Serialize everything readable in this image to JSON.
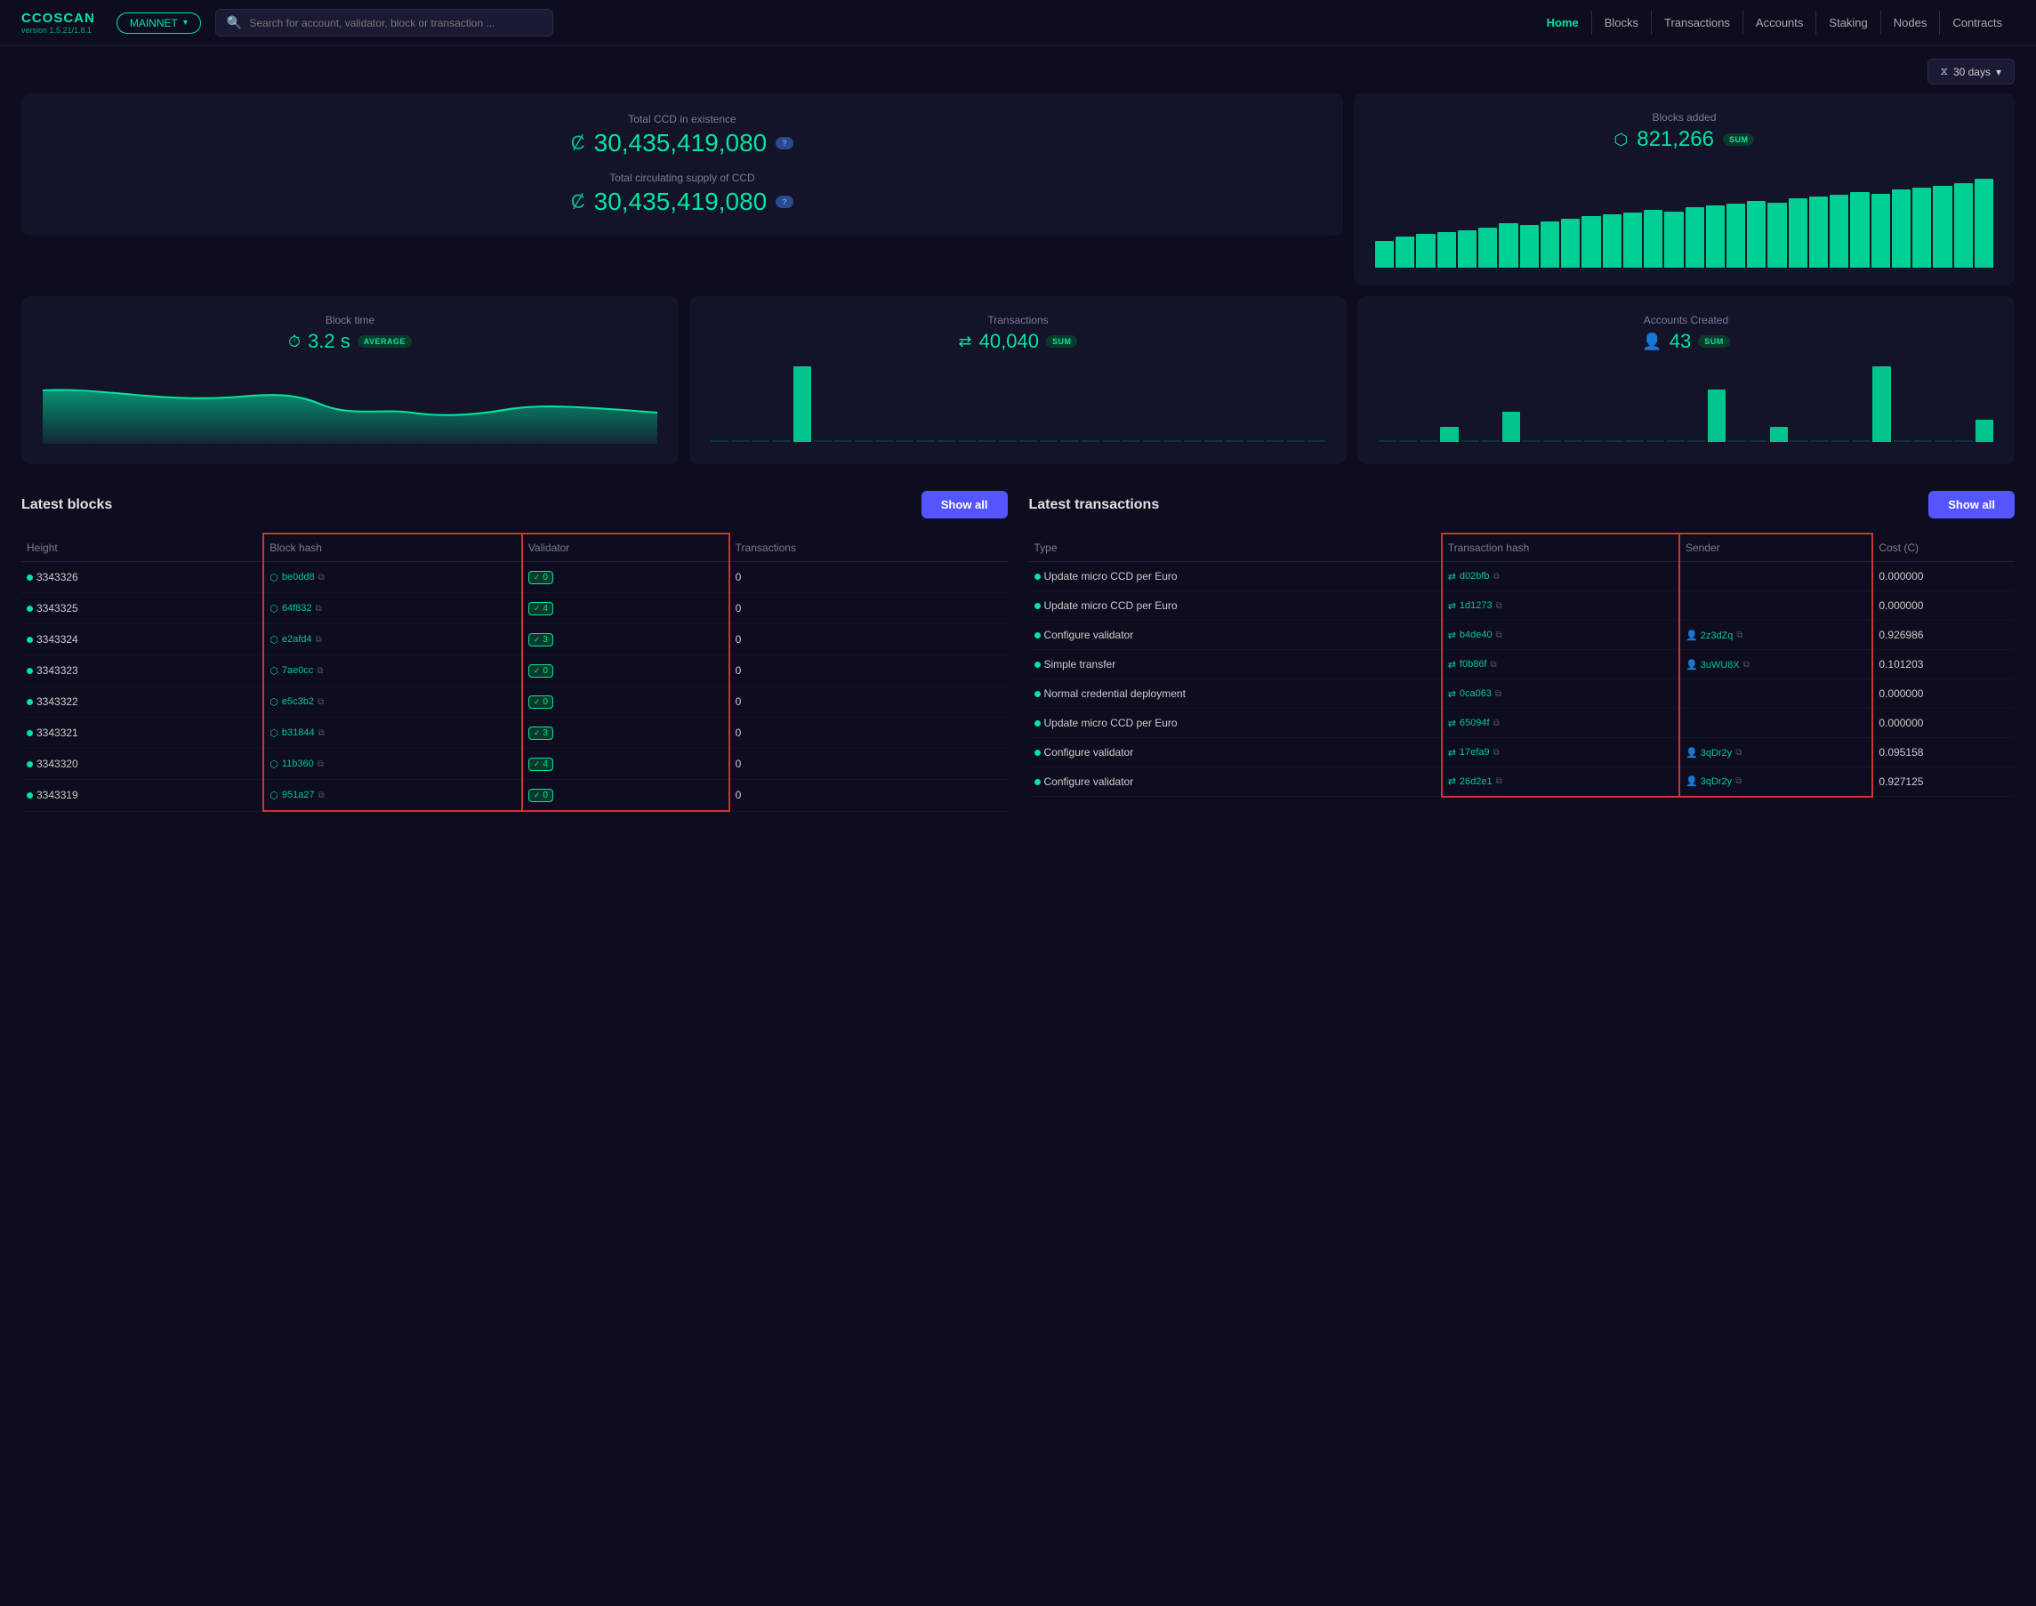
{
  "app": {
    "name": "CCOSCAN",
    "version": "version 1.5.21/1.8.1",
    "network": "MAINNET"
  },
  "header": {
    "search_placeholder": "Search for account, validator, block or transaction ...",
    "nav_items": [
      {
        "label": "Home",
        "active": true
      },
      {
        "label": "Blocks",
        "active": false
      },
      {
        "label": "Transactions",
        "active": false
      },
      {
        "label": "Accounts",
        "active": false
      },
      {
        "label": "Staking",
        "active": false
      },
      {
        "label": "Nodes",
        "active": false
      },
      {
        "label": "Contracts",
        "active": false
      }
    ]
  },
  "filter": {
    "label": "30 days"
  },
  "stats": {
    "total_ccd_label": "Total CCD in existence",
    "total_ccd_value": "30,435,419,080",
    "circulating_label": "Total circulating supply of CCD",
    "circulating_value": "30,435,419,080",
    "blocks_added_label": "Blocks added",
    "blocks_added_value": "821,266",
    "block_time_label": "Block time",
    "block_time_value": "3.2 s",
    "block_time_badge": "AVERAGE",
    "transactions_label": "Transactions",
    "transactions_value": "40,040",
    "transactions_badge": "SUM",
    "accounts_label": "Accounts Created",
    "accounts_value": "43",
    "accounts_badge": "SUM",
    "blocks_badge": "SUM"
  },
  "blocks": {
    "title": "Latest blocks",
    "show_all": "Show all",
    "columns": [
      "Height",
      "Block hash",
      "Validator",
      "Transactions"
    ],
    "rows": [
      {
        "height": "3343326",
        "hash": "be0dd8",
        "validator": "0",
        "transactions": "0"
      },
      {
        "height": "3343325",
        "hash": "64f832",
        "validator": "4",
        "transactions": "0"
      },
      {
        "height": "3343324",
        "hash": "e2afd4",
        "validator": "3",
        "transactions": "0"
      },
      {
        "height": "3343323",
        "hash": "7ae0cc",
        "validator": "0",
        "transactions": "0"
      },
      {
        "height": "3343322",
        "hash": "e5c3b2",
        "validator": "0",
        "transactions": "0"
      },
      {
        "height": "3343321",
        "hash": "b31844",
        "validator": "3",
        "transactions": "0"
      },
      {
        "height": "3343320",
        "hash": "11b360",
        "validator": "4",
        "transactions": "0"
      },
      {
        "height": "3343319",
        "hash": "951a27",
        "validator": "0",
        "transactions": "0"
      }
    ]
  },
  "transactions": {
    "title": "Latest transactions",
    "show_all": "Show all",
    "columns": [
      "Type",
      "Transaction hash",
      "Sender",
      "Cost (C)"
    ],
    "rows": [
      {
        "type": "Update micro CCD per Euro",
        "hash": "d02bfb",
        "sender": "",
        "cost": "0.000000"
      },
      {
        "type": "Update micro CCD per Euro",
        "hash": "1d1273",
        "sender": "",
        "cost": "0.000000"
      },
      {
        "type": "Configure validator",
        "hash": "b4de40",
        "sender": "2z3dZq",
        "cost": "0.926986"
      },
      {
        "type": "Simple transfer",
        "hash": "f0b86f",
        "sender": "3uWU8X",
        "cost": "0.101203"
      },
      {
        "type": "Normal credential deployment",
        "hash": "0ca063",
        "sender": "",
        "cost": "0.000000"
      },
      {
        "type": "Update micro CCD per Euro",
        "hash": "65094f",
        "sender": "",
        "cost": "0.000000"
      },
      {
        "type": "Configure validator",
        "hash": "17efa9",
        "sender": "3qDr2y",
        "cost": "0.095158"
      },
      {
        "type": "Configure validator",
        "hash": "26d2e1",
        "sender": "3qDr2y",
        "cost": "0.927125"
      }
    ]
  },
  "bar_heights": [
    30,
    35,
    38,
    40,
    42,
    45,
    50,
    48,
    52,
    55,
    58,
    60,
    62,
    65,
    63,
    68,
    70,
    72,
    75,
    73,
    78,
    80,
    82,
    85,
    83,
    88,
    90,
    92,
    95,
    100
  ],
  "tx_bar_heights": [
    0,
    0,
    0,
    0,
    85,
    0,
    0,
    0,
    0,
    0,
    0,
    0,
    0,
    0,
    0,
    0,
    0,
    0,
    0,
    0,
    0,
    0,
    0,
    0,
    0,
    0,
    0,
    0,
    0,
    0
  ],
  "accounts_bar_heights": [
    0,
    0,
    0,
    20,
    0,
    0,
    40,
    0,
    0,
    0,
    0,
    0,
    0,
    0,
    0,
    0,
    70,
    0,
    0,
    20,
    0,
    0,
    0,
    0,
    100,
    0,
    0,
    0,
    0,
    30
  ]
}
